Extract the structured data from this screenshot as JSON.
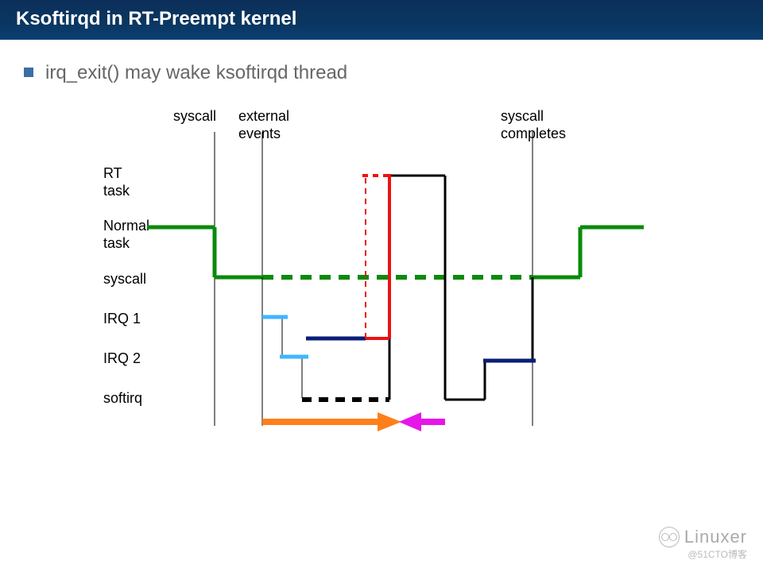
{
  "title": "Ksoftirqd in RT-Preempt kernel",
  "bullet": "irq_exit() may wake ksoftirqd thread",
  "columns": {
    "syscall": "syscall",
    "external": "external\nevents",
    "completes": "syscall\ncompletes"
  },
  "rows": {
    "rt": "RT\ntask",
    "normal": "Normal\ntask",
    "syscall": "syscall",
    "irq1": "IRQ 1",
    "irq2": "IRQ 2",
    "softirq": "softirq"
  },
  "watermark": {
    "name": "Linuxer",
    "sub": "@51CTO博客"
  },
  "chart_data": {
    "type": "timing-diagram",
    "description": "Timeline of task/IRQ execution levels when irq_exit wakes ksoftirqd under RT-Preempt",
    "time_markers": [
      "syscall",
      "external events",
      "syscall completes"
    ],
    "levels_top_to_bottom": [
      "RT task",
      "Normal task",
      "syscall",
      "IRQ 1",
      "IRQ 2",
      "softirq"
    ],
    "traces": {
      "normal_task_green": [
        {
          "seg": "solid",
          "from_level": "Normal task",
          "t": "before syscall"
        },
        {
          "seg": "drop",
          "to_level": "syscall",
          "t": "syscall"
        },
        {
          "seg": "dashed",
          "level": "syscall",
          "t": "syscall→external events→completes"
        },
        {
          "seg": "rise",
          "to_level": "Normal task",
          "t": "syscall completes"
        },
        {
          "seg": "solid",
          "level": "Normal task",
          "t": "after completes"
        }
      ],
      "irq_handling_black": [
        {
          "t": "external events",
          "drop_from": "syscall",
          "to": "IRQ 1"
        },
        {
          "to": "IRQ 2"
        },
        {
          "to": "softirq (dashed segment)"
        },
        {
          "rise_to": "IRQ 2"
        },
        {
          "rise_to": "syscall (returns)"
        },
        {
          "later_drop_to": "softirq"
        },
        {
          "rise_to": "IRQ 2"
        },
        {
          "rise_to": "syscall → completes"
        }
      ],
      "rt_task_red": [
        {
          "t": "after irq return",
          "dashed_rise_from": "IRQ 2",
          "to": "RT task"
        },
        {
          "solid": "RT task runs"
        },
        {
          "drop_to": "IRQ 2 / resume"
        }
      ],
      "irq_entries_light_blue": [
        "IRQ 1 short tick",
        "IRQ 2 short tick"
      ],
      "latency_arrows": {
        "orange_right_arrow": "from external events to RT task start",
        "magenta_left_arrow": "small back-arrow after RT task start"
      }
    }
  }
}
